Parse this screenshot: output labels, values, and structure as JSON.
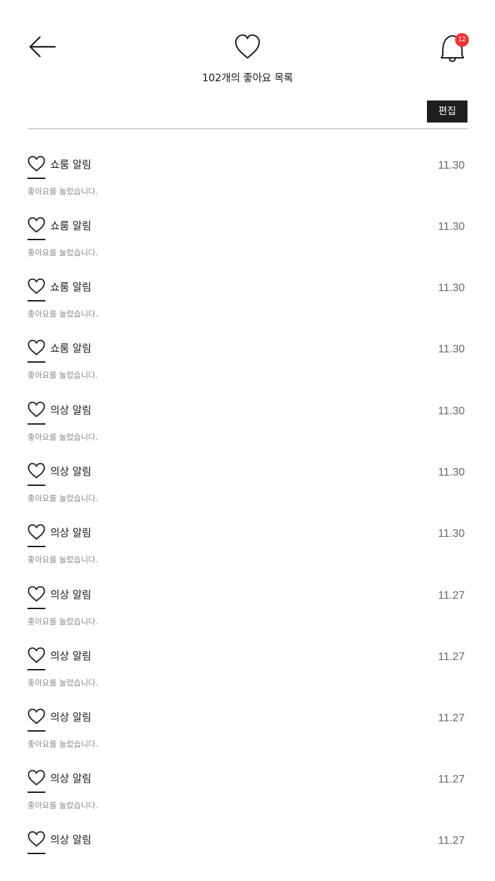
{
  "header": {
    "back_icon": "arrow-left-icon",
    "heart_icon": "heart-outline-icon",
    "bell_icon": "bell-icon",
    "notification_count": "12",
    "title": "102개의 좋아요 목록",
    "edit_label": "편집"
  },
  "colors": {
    "badge": "#ee3333",
    "edit_button_bg": "#1e1e1e",
    "divider": "#d2d2d2",
    "date_text": "#666666",
    "desc_text": "#888888"
  },
  "items": [
    {
      "label": "쇼룸 알림",
      "description": "좋아요를 눌렀습니다.",
      "date": "11.30"
    },
    {
      "label": "쇼룸 알림",
      "description": "좋아요를 눌렀습니다.",
      "date": "11.30"
    },
    {
      "label": "쇼룸 알림",
      "description": "좋아요를 눌렀습니다.",
      "date": "11.30"
    },
    {
      "label": "쇼룸 알림",
      "description": "좋아요를 눌렀습니다.",
      "date": "11.30"
    },
    {
      "label": "의상 알림",
      "description": "좋아요를 눌렀습니다.",
      "date": "11.30"
    },
    {
      "label": "의상 알림",
      "description": "좋아요를 눌렀습니다.",
      "date": "11.30"
    },
    {
      "label": "의상 알림",
      "description": "좋아요를 눌렀습니다.",
      "date": "11.30"
    },
    {
      "label": "의상 알림",
      "description": "좋아요를 눌렀습니다.",
      "date": "11.27"
    },
    {
      "label": "의상 알림",
      "description": "좋아요를 눌렀습니다.",
      "date": "11.27"
    },
    {
      "label": "의상 알림",
      "description": "좋아요를 눌렀습니다.",
      "date": "11.27"
    },
    {
      "label": "의상 알림",
      "description": "좋아요를 눌렀습니다.",
      "date": "11.27"
    },
    {
      "label": "의상 알림",
      "description": "",
      "date": "11.27"
    }
  ]
}
